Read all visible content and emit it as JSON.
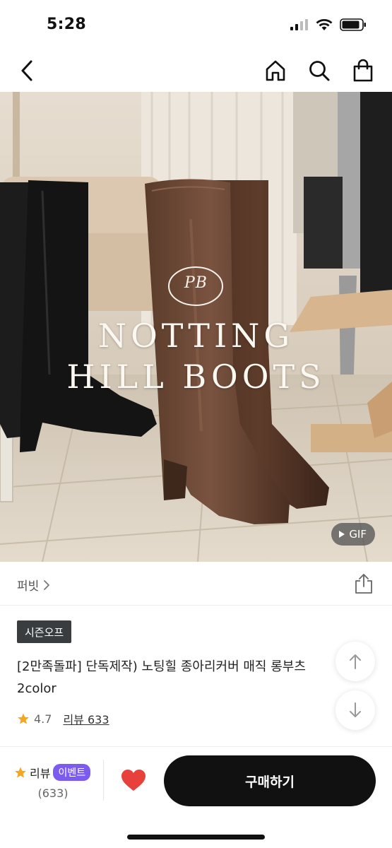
{
  "status_bar": {
    "time": "5:28"
  },
  "nav": {
    "back_icon": "chevron-left-icon",
    "home_icon": "home-icon",
    "search_icon": "search-icon",
    "cart_icon": "shopping-bag-icon"
  },
  "hero": {
    "logo_monogram": "PB",
    "brand_line1": "NOTTING",
    "brand_line2": "HILL BOOTS",
    "gif_label": "GIF"
  },
  "brand": {
    "name": "퍼빗",
    "share_icon": "share-icon"
  },
  "product": {
    "tag": "시즌오프",
    "title": "[2만족돌파] 단독제작) 노팅힐 종아리커버 매직 롱부츠 2color",
    "rating": "4.7",
    "review_link": "리뷰 633"
  },
  "bottom_bar": {
    "review_label": "리뷰",
    "event_badge": "이벤트",
    "review_count": "(633)",
    "buy_label": "구매하기"
  },
  "colors": {
    "accent_black": "#111111",
    "event_purple": "#7c5cf0",
    "heart_red": "#e8403a",
    "star_yellow": "#f5a623",
    "tag_bg": "#3a3d40"
  }
}
